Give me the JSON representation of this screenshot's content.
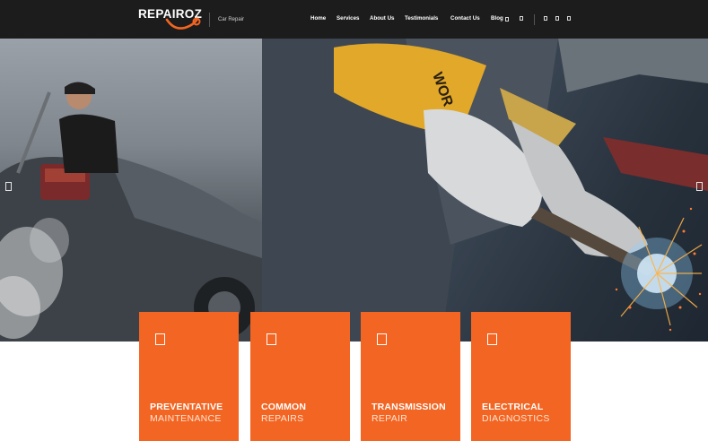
{
  "brand": {
    "logo_text": "REPAIROZ",
    "tagline": "Car Repair",
    "accent_color": "#f26522"
  },
  "nav": {
    "items": [
      "Home",
      "Services",
      "About Us",
      "Testimonials",
      "Contact Us",
      "Blog"
    ],
    "icons": [
      "dropdown-icon",
      "search-icon",
      "facebook-icon",
      "twitter-icon",
      "instagram-icon"
    ]
  },
  "hero": {
    "prev_icon": "chevron-left-icon",
    "next_icon": "chevron-right-icon"
  },
  "services": [
    {
      "title": "PREVENTATIVE",
      "subtitle": "MAINTENANCE",
      "icon": "wrench-icon"
    },
    {
      "title": "COMMON",
      "subtitle": "REPAIRS",
      "icon": "car-icon"
    },
    {
      "title": "TRANSMISSION",
      "subtitle": "REPAIR",
      "icon": "gear-icon"
    },
    {
      "title": "ELECTRICAL",
      "subtitle": "DIAGNOSTICS",
      "icon": "battery-icon"
    }
  ]
}
